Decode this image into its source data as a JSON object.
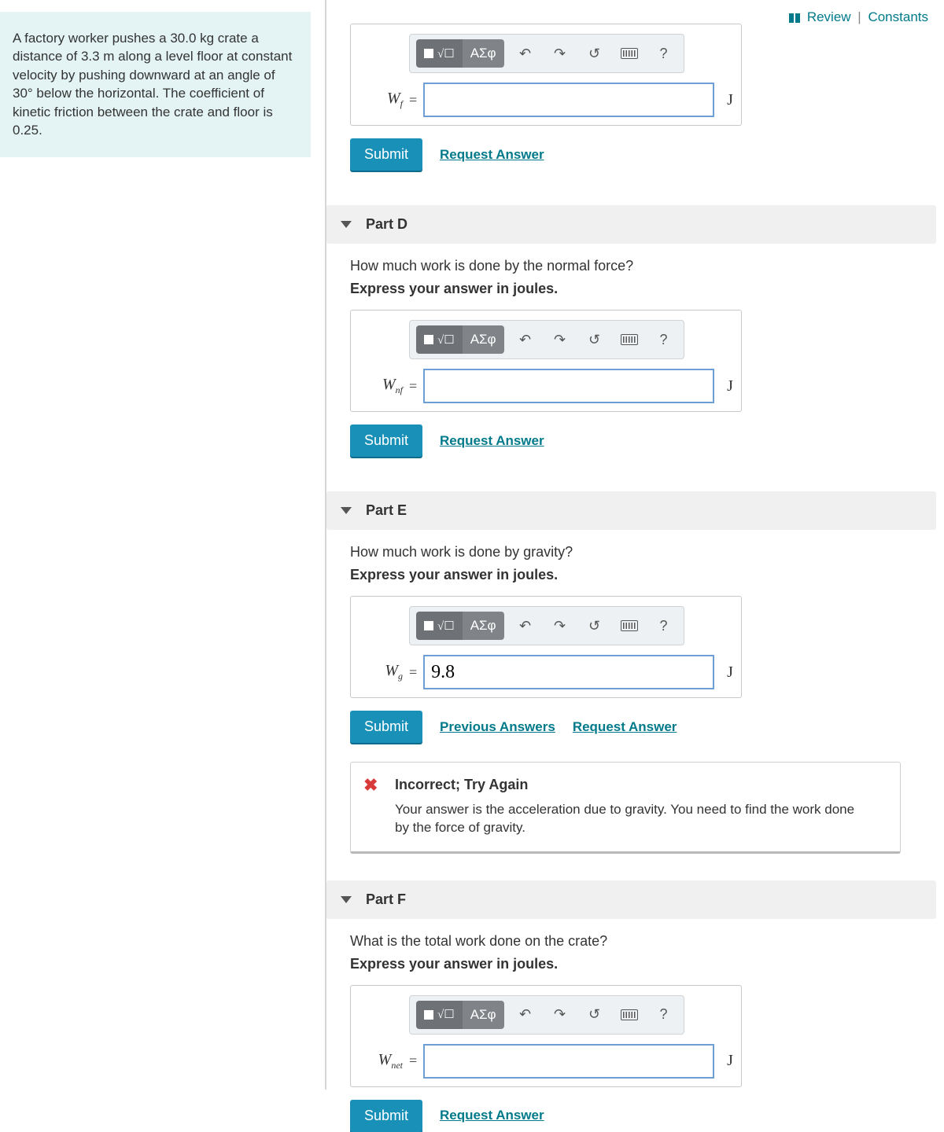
{
  "top_links": {
    "review": "Review",
    "constants": "Constants"
  },
  "problem_text": "A factory worker pushes a 30.0 kg crate a distance of 3.3 m along a level floor at constant velocity by pushing downward at an angle of 30° below the horizontal. The coefficient of kinetic friction between the crate and floor is 0.25.",
  "toolbar": {
    "math_tab": "√☐",
    "greek_tab": "ΑΣφ",
    "help": "?"
  },
  "part_c": {
    "var_html": "W<sub>f</sub>",
    "unit": "J",
    "value": "",
    "submit": "Submit",
    "request": "Request Answer"
  },
  "part_d": {
    "title": "Part D",
    "question": "How much work is done by the normal force?",
    "instruction": "Express your answer in joules.",
    "var_html": "W<sub>nf</sub>",
    "unit": "J",
    "value": "",
    "submit": "Submit",
    "request": "Request Answer"
  },
  "part_e": {
    "title": "Part E",
    "question": "How much work is done by gravity?",
    "instruction": "Express your answer in joules.",
    "var_html": "W<sub>g</sub>",
    "unit": "J",
    "value": "9.8",
    "submit": "Submit",
    "previous": "Previous Answers",
    "request": "Request Answer",
    "feedback_title": "Incorrect; Try Again",
    "feedback_msg": "Your answer is the acceleration due to gravity. You need to find the work done by the force of gravity."
  },
  "part_f": {
    "title": "Part F",
    "question": "What is the total work done on the crate?",
    "instruction": "Express your answer in joules.",
    "var_html": "W<sub>net</sub>",
    "unit": "J",
    "value": "",
    "submit": "Submit",
    "request": "Request Answer"
  }
}
